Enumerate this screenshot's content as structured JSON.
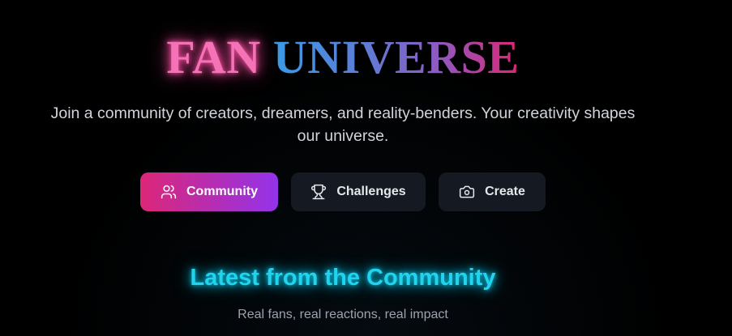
{
  "hero": {
    "title_part1": "FAN",
    "title_part2": "UNIVERSE",
    "subtitle": "Join a community of creators, dreamers, and reality-benders. Your creativity shapes our universe."
  },
  "nav": {
    "items": [
      {
        "label": "Community",
        "icon": "users-icon",
        "active": true
      },
      {
        "label": "Challenges",
        "icon": "trophy-icon",
        "active": false
      },
      {
        "label": "Create",
        "icon": "camera-icon",
        "active": false
      }
    ]
  },
  "section": {
    "title": "Latest from the Community",
    "subtitle": "Real fans, real reactions, real impact"
  },
  "colors": {
    "background": "#000000",
    "title_fan_glow": "#ec4899",
    "active_gradient_start": "#db2777",
    "active_gradient_end": "#9333ea",
    "inactive_button": "#151a22",
    "section_title_glow": "#22d3ee"
  }
}
